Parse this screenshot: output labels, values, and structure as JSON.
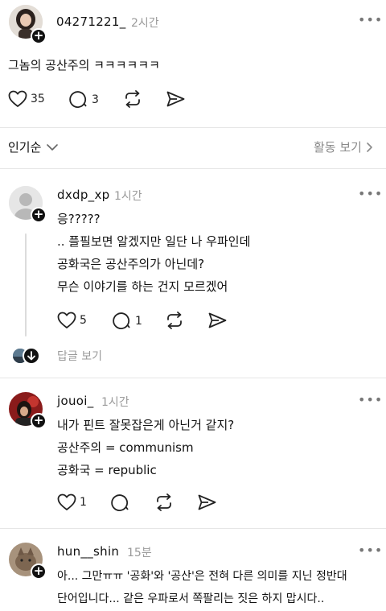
{
  "post": {
    "username": "04271221_",
    "time": "2시간",
    "text": "그놈의 공산주의 ㅋㅋㅋㅋㅋㅋ",
    "likes": "35",
    "comments": "3"
  },
  "sort_bar": {
    "sort_label": "인기순",
    "activity_label": "활동 보기"
  },
  "replies": [
    {
      "username": "dxdp_xp",
      "time": "1시간",
      "lines": [
        "응?????",
        ".. 플필보면 알겠지만 일단 나 우파인데",
        "공화국은 공산주의가 아닌데?",
        "무슨 이야기를 하는 건지 모르겠어"
      ],
      "likes": "5",
      "comments": "1",
      "view_replies": "답글 보기"
    },
    {
      "username": "jouoi_",
      "time": "1시간",
      "lines": [
        "내가 핀트 잘못잡은게 아닌거 같지?",
        "공산주의 = communism",
        "공화국 = republic"
      ],
      "likes": "1"
    },
    {
      "username": "hun__shin",
      "time": "15분",
      "lines": [
        "아... 그만ㅠㅠ '공화'와 '공산'은 전혀 다른 의미를 지닌 정반대",
        "단어입니다... 같은 우파로서 쪽팔리는 짓은 하지 맙시다.."
      ]
    }
  ]
}
